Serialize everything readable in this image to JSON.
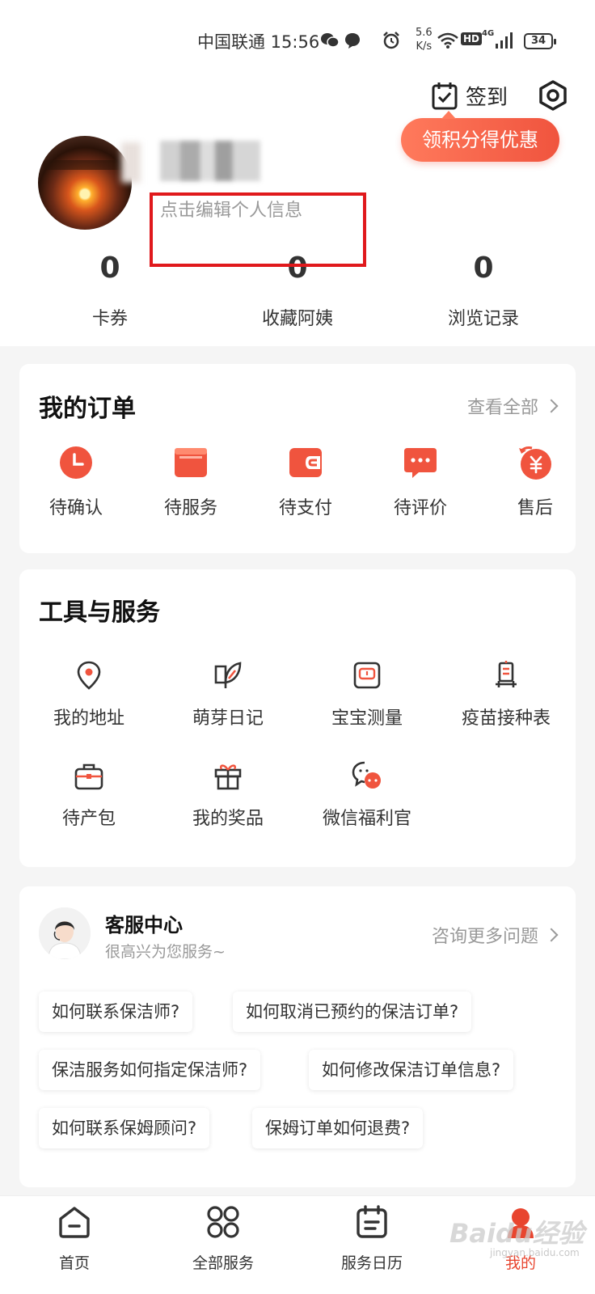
{
  "status_bar": {
    "carrier_time": "中国联通 15:56",
    "net_speed_value": "5.6",
    "net_speed_unit": "K/s",
    "hd": "HD",
    "net_type": "4G",
    "battery": "34"
  },
  "profile": {
    "checkin_label": "签到",
    "promo_pill": "领积分得优惠",
    "edit_info": "点击编辑个人信息",
    "stats": [
      {
        "value": "0",
        "label": "卡券"
      },
      {
        "value": "0",
        "label": "收藏阿姨"
      },
      {
        "value": "0",
        "label": "浏览记录"
      }
    ]
  },
  "orders": {
    "title": "我的订单",
    "view_all": "查看全部",
    "items": [
      {
        "label": "待确认",
        "icon": "clock-icon"
      },
      {
        "label": "待服务",
        "icon": "calendar-card-icon"
      },
      {
        "label": "待支付",
        "icon": "wallet-icon"
      },
      {
        "label": "待评价",
        "icon": "chat-bubble-icon"
      },
      {
        "label": "售后",
        "icon": "refund-yen-icon"
      }
    ]
  },
  "tools": {
    "title": "工具与服务",
    "items": [
      {
        "label": "我的地址",
        "icon": "location-pin-icon"
      },
      {
        "label": "萌芽日记",
        "icon": "sprout-diary-icon"
      },
      {
        "label": "宝宝测量",
        "icon": "scale-icon"
      },
      {
        "label": "疫苗接种表",
        "icon": "vaccine-icon"
      },
      {
        "label": "待产包",
        "icon": "bag-icon"
      },
      {
        "label": "我的奖品",
        "icon": "gift-icon"
      },
      {
        "label": "微信福利官",
        "icon": "wechat-chat-icon"
      }
    ]
  },
  "customer_service": {
    "title": "客服中心",
    "subtitle": "很高兴为您服务~",
    "more": "咨询更多问题",
    "faqs": [
      "如何联系保洁师?",
      "如何取消已预约的保洁订单?",
      "保洁服务如何指定保洁师?",
      "如何修改保洁订单信息?",
      "如何联系保姆顾问?",
      "保姆订单如何退费?"
    ]
  },
  "bottom_nav": {
    "items": [
      {
        "label": "首页",
        "icon": "home-icon"
      },
      {
        "label": "全部服务",
        "icon": "grid-circles-icon"
      },
      {
        "label": "服务日历",
        "icon": "calendar-icon"
      },
      {
        "label": "我的",
        "icon": "profile-icon"
      }
    ],
    "active": "我的"
  },
  "watermark": {
    "brand": "Baidu经验",
    "url": "jingyan.baidu.com"
  },
  "colors": {
    "accent": "#f0543e",
    "annotation_red": "#e0191c",
    "page_bg": "#f5f5f5"
  }
}
